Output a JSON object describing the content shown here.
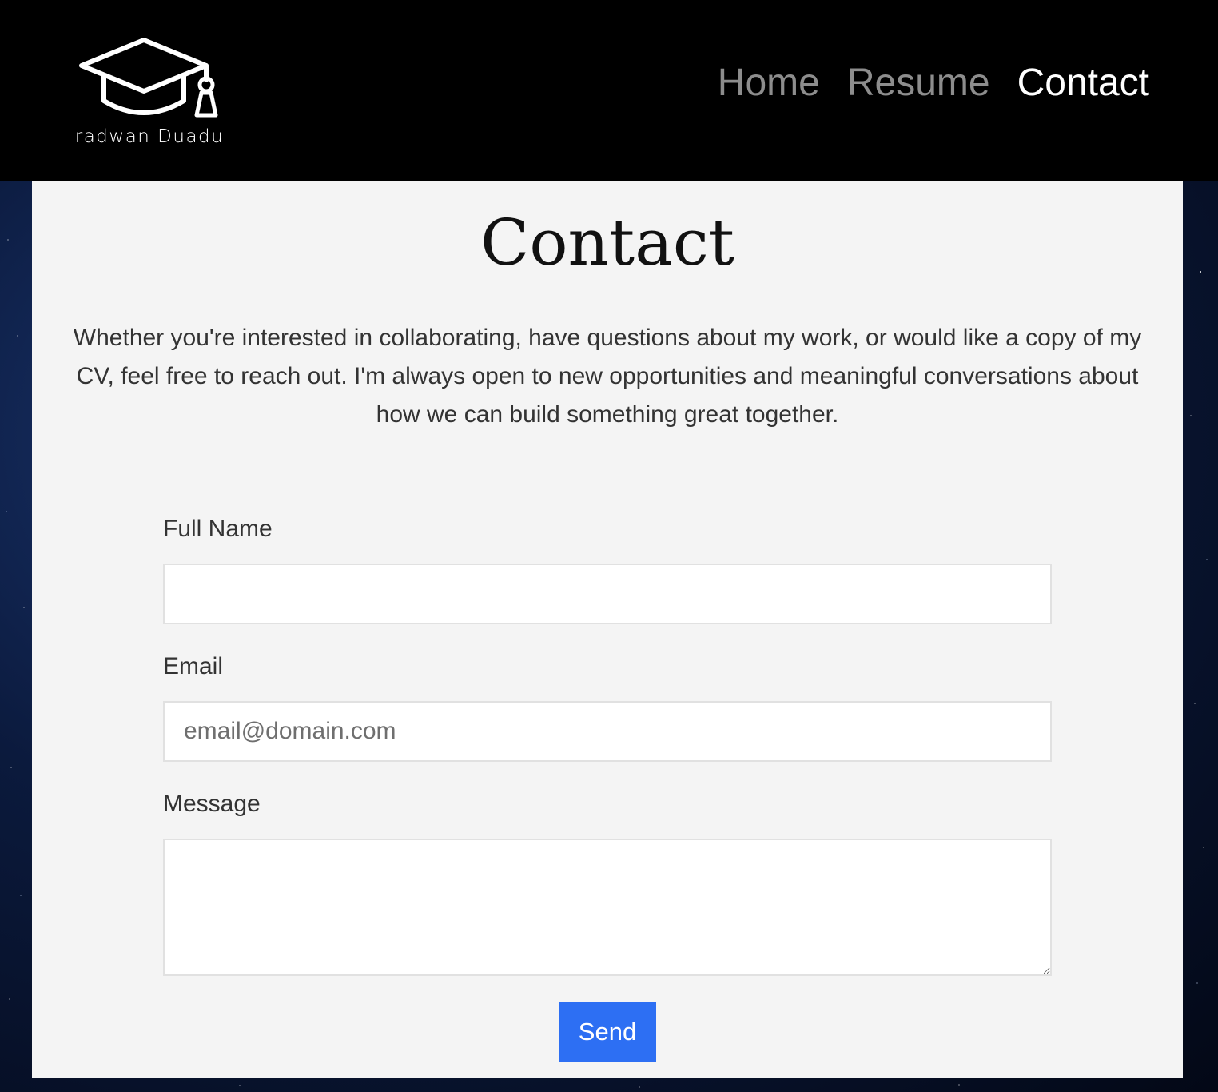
{
  "brand": {
    "name": "radwan Duadu",
    "logo_icon": "graduation-cap-icon"
  },
  "nav": {
    "items": [
      {
        "label": "Home"
      },
      {
        "label": "Resume"
      },
      {
        "label": "Contact",
        "active": true
      }
    ]
  },
  "page": {
    "title": "Contact",
    "intro": "Whether you're interested in collaborating, have questions about my work, or would like a copy of my CV, feel free to reach out. I'm always open to new opportunities and meaningful conversations about how we can build something great together."
  },
  "form": {
    "full_name": {
      "label": "Full Name",
      "value": "",
      "placeholder": ""
    },
    "email": {
      "label": "Email",
      "value": "",
      "placeholder": "email@domain.com"
    },
    "message": {
      "label": "Message",
      "value": "",
      "placeholder": ""
    },
    "submit_label": "Send"
  },
  "colors": {
    "navbar_bg": "#000000",
    "nav_inactive": "#8d8d8d",
    "nav_active": "#ffffff",
    "card_bg": "#f4f4f4",
    "button": "#2d6ff3"
  }
}
